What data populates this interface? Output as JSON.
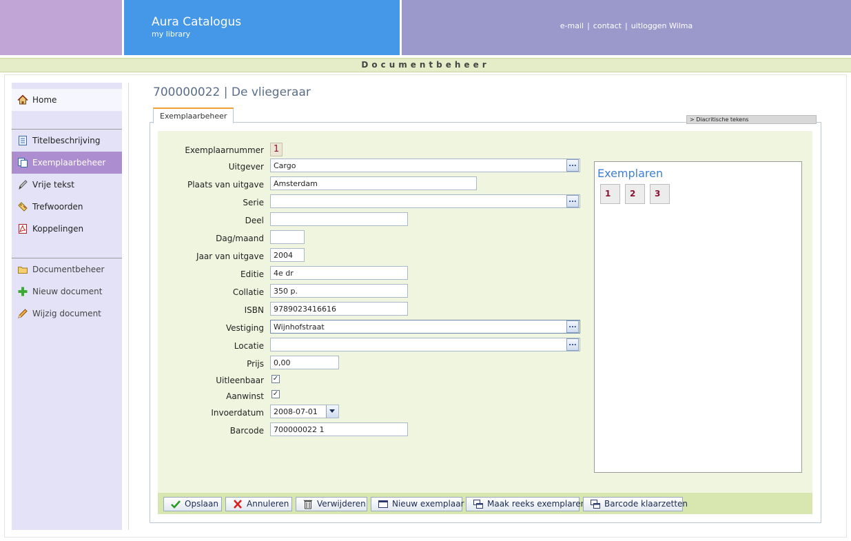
{
  "header": {
    "app_title": "Aura Catalogus",
    "app_subtitle": "my library",
    "links": {
      "email": "e-mail",
      "contact": "contact",
      "logout": "uitloggen Wilma"
    }
  },
  "section_title": "Documentbeheer",
  "sidebar": {
    "items": [
      {
        "label": "Home",
        "icon": "home-icon"
      },
      {
        "label": "Titelbeschrijving",
        "icon": "document-icon"
      },
      {
        "label": "Exemplaarbeheer",
        "icon": "copies-icon",
        "active": true
      },
      {
        "label": "Vrije tekst",
        "icon": "pen-icon"
      },
      {
        "label": "Trefwoorden",
        "icon": "tag-icon"
      },
      {
        "label": "Koppelingen",
        "icon": "pdf-icon"
      },
      {
        "label": "Documentbeheer",
        "icon": "folder-icon"
      },
      {
        "label": "Nieuw document",
        "icon": "plus-icon"
      },
      {
        "label": "Wijzig document",
        "icon": "pencil-icon"
      }
    ]
  },
  "page_title": "700000022 | De vliegeraar",
  "tab_label": "Exemplaarbeheer",
  "diacritics_label": "> Diacritische tekens",
  "form": {
    "exemplaarnummer": {
      "label": "Exemplaarnummer",
      "value": "1"
    },
    "uitgever": {
      "label": "Uitgever",
      "value": "Cargo"
    },
    "plaats": {
      "label": "Plaats van uitgave",
      "value": "Amsterdam"
    },
    "serie": {
      "label": "Serie",
      "value": ""
    },
    "deel": {
      "label": "Deel",
      "value": ""
    },
    "dagmaand": {
      "label": "Dag/maand",
      "value": ""
    },
    "jaar": {
      "label": "Jaar van uitgave",
      "value": "2004"
    },
    "editie": {
      "label": "Editie",
      "value": "4e dr"
    },
    "collatie": {
      "label": "Collatie",
      "value": "350 p."
    },
    "isbn": {
      "label": "ISBN",
      "value": "9789023416616"
    },
    "vestiging": {
      "label": "Vestiging",
      "value": "Wijnhofstraat"
    },
    "locatie": {
      "label": "Locatie",
      "value": ""
    },
    "prijs": {
      "label": "Prijs",
      "value": "0,00"
    },
    "uitleenbaar": {
      "label": "Uitleenbaar",
      "checked": true
    },
    "aanwinst": {
      "label": "Aanwinst",
      "checked": true
    },
    "invoerdatum": {
      "label": "Invoerdatum",
      "value": "2008-07-01"
    },
    "barcode": {
      "label": "Barcode",
      "value": "700000022 1"
    },
    "ellipsis": "..."
  },
  "exemplaren": {
    "title": "Exemplaren",
    "items": [
      "1",
      "2",
      "3"
    ]
  },
  "buttons": {
    "save": "Opslaan",
    "cancel": "Annuleren",
    "delete": "Verwijderen",
    "new_copy": "Nieuw exemplaar",
    "series": "Maak reeks exemplaren",
    "barcode": "Barcode klaarzetten"
  },
  "colors": {
    "accent_blue": "#4597e8",
    "header_purple": "#c0a5d6",
    "header_violet": "#9b99cc",
    "active_nav": "#ab8dd0"
  }
}
